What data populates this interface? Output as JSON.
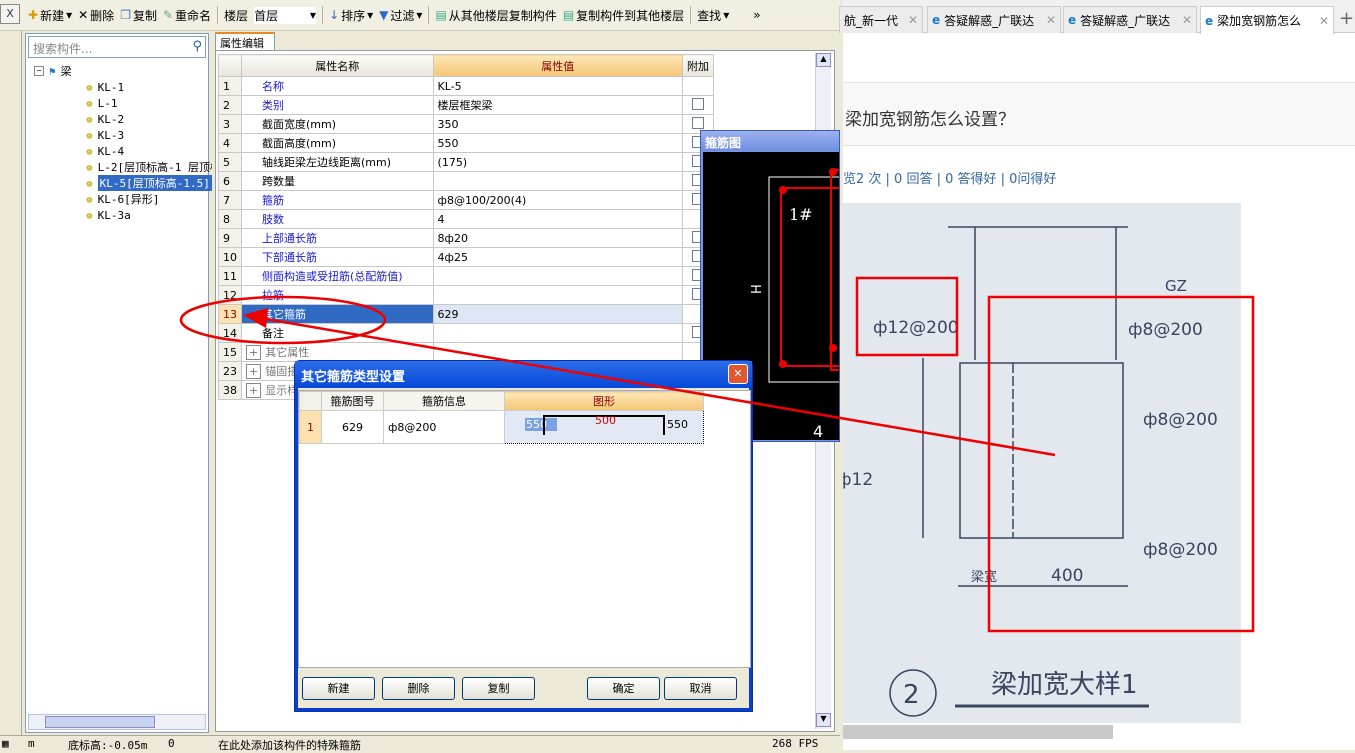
{
  "toolbar": {
    "close": "X",
    "new": "新建",
    "delete": "删除",
    "copy": "复制",
    "rename": "重命名",
    "floor_label": "楼层",
    "floor_value": "首层",
    "sort": "排序",
    "filter": "过滤",
    "copy_from": "从其他楼层复制构件",
    "copy_to": "复制构件到其他楼层",
    "find": "查找",
    "more": "»"
  },
  "tree": {
    "search_placeholder": "搜索构件...",
    "root": "梁",
    "items": [
      "KL-1",
      "L-1",
      "KL-2",
      "KL-3",
      "KL-4",
      "L-2[层顶标高-1 层顶标",
      "KL-5[层顶标高-1.5]",
      "KL-6[异形]",
      "KL-3a"
    ],
    "selected_index": 6
  },
  "props": {
    "tab": "属性编辑",
    "headers": {
      "name": "属性名称",
      "value": "属性值",
      "extra": "附加"
    },
    "rows": [
      {
        "n": "1",
        "name": "名称",
        "value": "KL-5",
        "blue": true,
        "cb": false
      },
      {
        "n": "2",
        "name": "类别",
        "value": "楼层框架梁",
        "blue": true,
        "cb": true
      },
      {
        "n": "3",
        "name": "截面宽度(mm)",
        "value": "350",
        "blue": false,
        "cb": true
      },
      {
        "n": "4",
        "name": "截面高度(mm)",
        "value": "550",
        "blue": false,
        "cb": true
      },
      {
        "n": "5",
        "name": "轴线距梁左边线距离(mm)",
        "value": "(175)",
        "blue": false,
        "cb": true
      },
      {
        "n": "6",
        "name": "跨数量",
        "value": "",
        "blue": false,
        "cb": true
      },
      {
        "n": "7",
        "name": "箍筋",
        "value": "ф8@100/200(4)",
        "blue": true,
        "cb": true
      },
      {
        "n": "8",
        "name": "肢数",
        "value": "4",
        "blue": true,
        "cb": false
      },
      {
        "n": "9",
        "name": "上部通长筋",
        "value": "8ф20",
        "blue": true,
        "cb": true
      },
      {
        "n": "10",
        "name": "下部通长筋",
        "value": "4ф25",
        "blue": true,
        "cb": true
      },
      {
        "n": "11",
        "name": "侧面构造或受扭筋(总配筋值)",
        "value": "",
        "blue": true,
        "cb": true
      },
      {
        "n": "12",
        "name": "拉筋",
        "value": "",
        "blue": true,
        "cb": true
      },
      {
        "n": "13",
        "name": "其它箍筋",
        "value": "629",
        "blue": false,
        "cb": false,
        "selected": true
      },
      {
        "n": "14",
        "name": "备注",
        "value": "",
        "blue": false,
        "cb": true
      },
      {
        "n": "15",
        "name": "其它属性",
        "value": "",
        "group": true
      },
      {
        "n": "23",
        "name": "锚固搭接",
        "value": "",
        "group": true
      },
      {
        "n": "38",
        "name": "显示样式",
        "value": "",
        "group": true
      }
    ]
  },
  "rebar_window": {
    "title": "箍筋图",
    "label_h": "H",
    "label_1": "1#",
    "label_4": "4"
  },
  "dialog": {
    "title": "其它箍筋类型设置",
    "headers": [
      "箍筋图号",
      "箍筋信息",
      "图形"
    ],
    "row": {
      "n": "1",
      "code": "629",
      "info": "ф8@200",
      "left": "550",
      "mid": "500",
      "right": "550"
    },
    "buttons": {
      "new": "新建",
      "delete": "删除",
      "copy": "复制",
      "ok": "确定",
      "cancel": "取消"
    }
  },
  "status": {
    "a": "m",
    "b": "底标高:-0.05m",
    "c": "0",
    "d": "在此处添加该构件的特殊箍筋",
    "fps": "268 FPS"
  },
  "browser": {
    "tabs": [
      "航_新一代",
      "答疑解惑_广联达",
      "答疑解惑_广联达",
      "梁加宽钢筋怎么"
    ],
    "new_tab": "+",
    "question": "梁加宽钢筋怎么设置？",
    "stats": "览2 次 | 0 回答 | 0 答得好 | 0问得好",
    "photo": {
      "t1": "ф12@200",
      "t2": "ф8@200",
      "t3": "ф8@200",
      "t4": "ф8@200",
      "gz": "GZ",
      "dim": "400",
      "width": "梁宽",
      "e12": "ф12",
      "num": "2",
      "caption": "梁加宽大样1"
    }
  },
  "colors": {
    "selection": "#316ac5",
    "annotation": "#e00000",
    "header": "#f4c674"
  }
}
